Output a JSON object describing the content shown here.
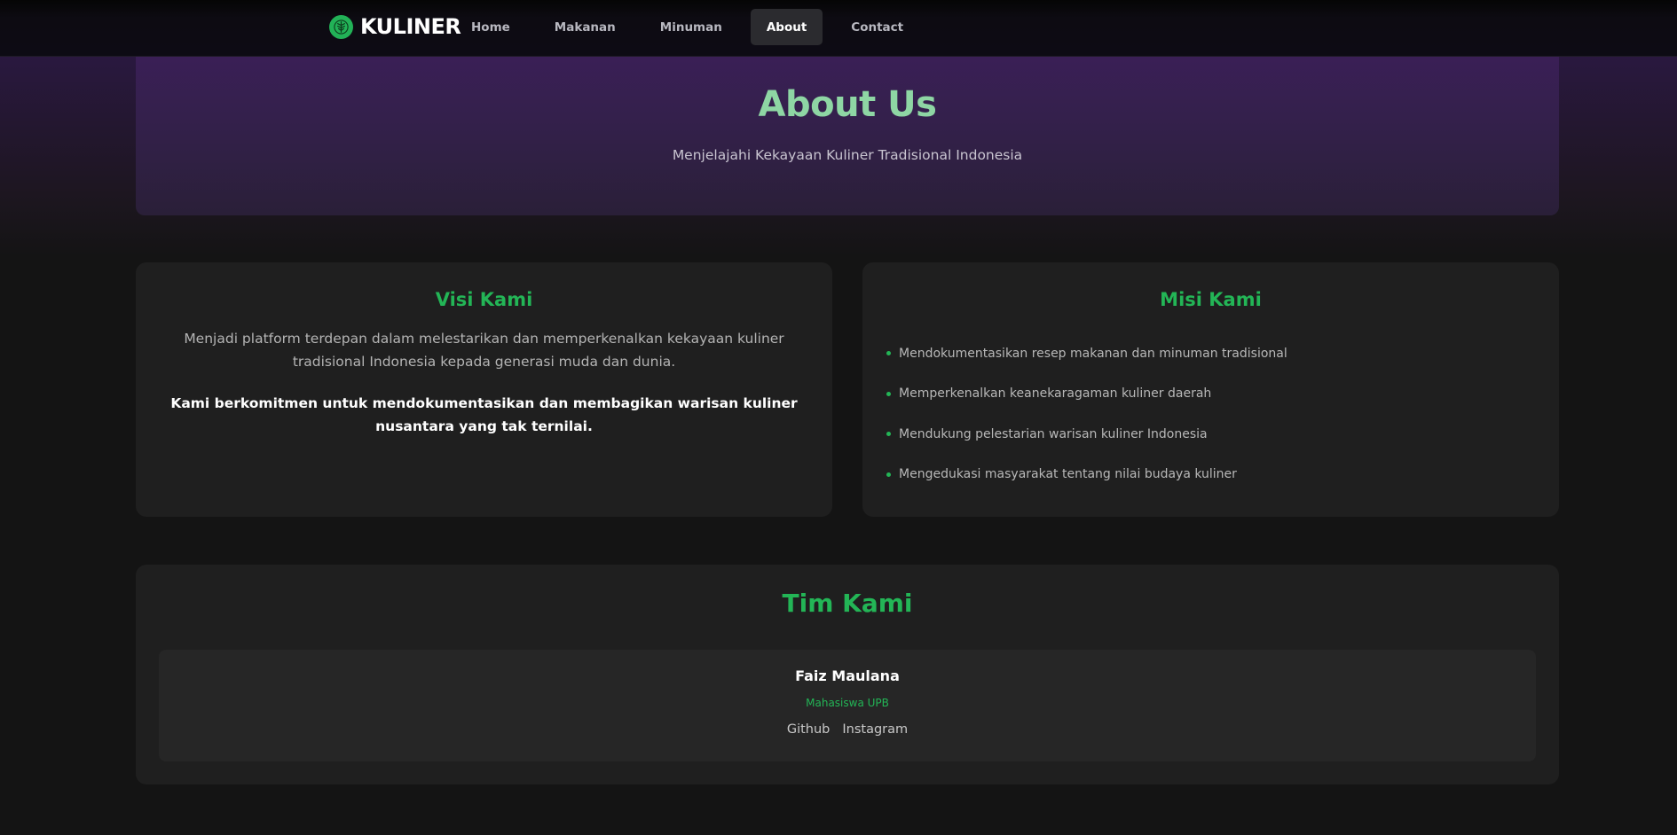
{
  "colors": {
    "accent": "#23b556",
    "hero_title": "#8ed6a4",
    "background": "#141414",
    "card": "#1f1f1f",
    "hero_purple": "#3a1f56"
  },
  "navbar": {
    "brand": "KULINER",
    "logo_icon": "leaf-emblem-icon",
    "links": [
      {
        "label": "Home"
      },
      {
        "label": "Makanan"
      },
      {
        "label": "Minuman"
      },
      {
        "label": "About",
        "active": true
      },
      {
        "label": "Contact"
      }
    ]
  },
  "hero": {
    "title": "About Us",
    "subtitle": "Menjelajahi Kekayaan Kuliner Tradisional Indonesia"
  },
  "visi": {
    "title": "Visi Kami",
    "text": "Menjadi platform terdepan dalam melestarikan dan memperkenalkan kekayaan kuliner tradisional Indonesia kepada generasi muda dan dunia.",
    "commitment": "Kami berkomitmen untuk mendokumentasikan dan membagikan warisan kuliner nusantara yang tak ternilai."
  },
  "misi": {
    "title": "Misi Kami",
    "items": [
      "Mendokumentasikan resep makanan dan minuman tradisional",
      "Memperkenalkan keanekaragaman kuliner daerah",
      "Mendukung pelestarian warisan kuliner Indonesia",
      "Mengedukasi masyarakat tentang nilai budaya kuliner"
    ]
  },
  "tim": {
    "title": "Tim Kami",
    "members": [
      {
        "name": "Faiz Maulana",
        "role": "Mahasiswa UPB",
        "links": [
          "Github",
          "Instagram"
        ]
      }
    ]
  }
}
